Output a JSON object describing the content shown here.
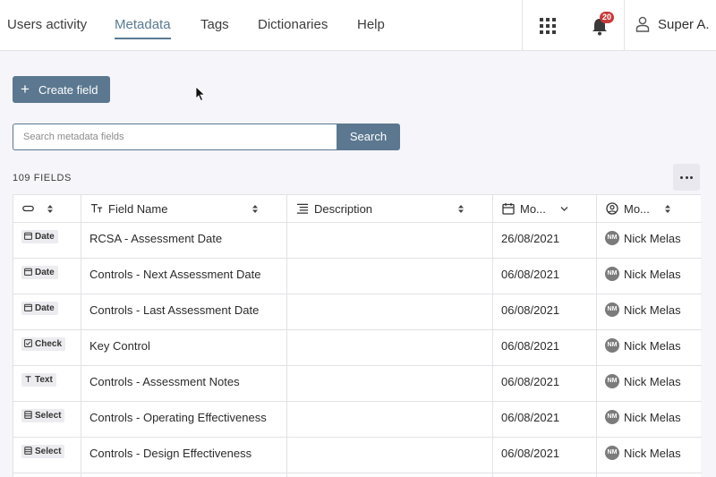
{
  "nav": {
    "items": [
      {
        "label": "Users activity",
        "active": false
      },
      {
        "label": "Metadata",
        "active": true
      },
      {
        "label": "Tags",
        "active": false
      },
      {
        "label": "Dictionaries",
        "active": false
      },
      {
        "label": "Help",
        "active": false
      }
    ],
    "notifications_count": "20",
    "user_name": "Super A."
  },
  "toolbar": {
    "create_label": "Create field",
    "create_icon": "plus-icon"
  },
  "search": {
    "placeholder": "Search metadata fields",
    "value": "",
    "button_label": "Search"
  },
  "field_count": "109 FIELDS",
  "table": {
    "columns": [
      {
        "label": "",
        "icon": "link-icon"
      },
      {
        "label": "Field Name",
        "icon": "text-format-icon"
      },
      {
        "label": "Description",
        "icon": "align-left-icon"
      },
      {
        "label": "Mo...",
        "icon": "calendar-icon"
      },
      {
        "label": "Mo...",
        "icon": "user-circle-icon"
      }
    ],
    "rows": [
      {
        "type": "Date",
        "type_icon": "calendar-icon",
        "name": "RCSA - Assessment Date",
        "description": "",
        "modified": "26/08/2021",
        "initials": "NM",
        "modified_by": "Nick Melas"
      },
      {
        "type": "Date",
        "type_icon": "calendar-icon",
        "name": "Controls - Next Assessment Date",
        "description": "",
        "modified": "06/08/2021",
        "initials": "NM",
        "modified_by": "Nick Melas"
      },
      {
        "type": "Date",
        "type_icon": "calendar-icon",
        "name": "Controls - Last Assessment Date",
        "description": "",
        "modified": "06/08/2021",
        "initials": "NM",
        "modified_by": "Nick Melas"
      },
      {
        "type": "Check",
        "type_icon": "checkbox-icon",
        "name": "Key Control",
        "description": "",
        "modified": "06/08/2021",
        "initials": "NM",
        "modified_by": "Nick Melas"
      },
      {
        "type": "Text",
        "type_icon": "text-icon",
        "name": "Controls - Assessment Notes",
        "description": "",
        "modified": "06/08/2021",
        "initials": "NM",
        "modified_by": "Nick Melas"
      },
      {
        "type": "Select",
        "type_icon": "list-icon",
        "name": "Controls - Operating Effectiveness",
        "description": "",
        "modified": "06/08/2021",
        "initials": "NM",
        "modified_by": "Nick Melas"
      },
      {
        "type": "Select",
        "type_icon": "list-icon",
        "name": "Controls - Design Effectiveness",
        "description": "",
        "modified": "06/08/2021",
        "initials": "NM",
        "modified_by": "Nick Melas"
      }
    ]
  },
  "colors": {
    "accent": "#5b7890",
    "badge": "#c93a3a",
    "background": "#f6f5f9"
  }
}
